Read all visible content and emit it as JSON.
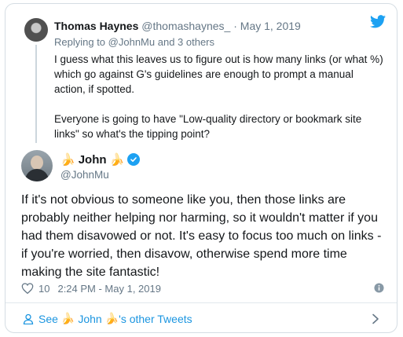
{
  "reply": {
    "name": "Thomas Haynes",
    "handle": "@thomashaynes_",
    "dot": "·",
    "date": "May 1, 2019",
    "replying_prefix": "Replying to",
    "replying_users": "@JohnMu and 3 others",
    "paragraph1": "I guess what this leaves us to figure out is how many links (or what %) which go against G's guidelines are enough to prompt a manual action, if spotted.",
    "paragraph2": "Everyone is going to have \"Low-quality directory or bookmark site links\" so what's the tipping point?"
  },
  "tweet": {
    "name_emoji_left": "🍌",
    "name": "John",
    "name_emoji_right": "🍌",
    "handle": "@JohnMu",
    "text": "If it's not obvious to someone like you, then those links are probably neither helping nor harming, so it wouldn't matter if you had them disavowed or not. It's easy to focus too much on links - if you're worried, then disavow, otherwise spend more time making the site fantastic!",
    "likes": "10",
    "timestamp": "2:24 PM - May 1, 2019"
  },
  "footer": {
    "see": "See",
    "emoji_left": "🍌",
    "name": "John",
    "emoji_right": "🍌",
    "suffix": "'s other Tweets"
  },
  "icons": {
    "brand": "twitter-bird-icon",
    "verified": "verified-badge-icon",
    "like": "heart-icon",
    "info": "info-icon",
    "user": "user-icon",
    "chevron": "chevron-right-icon"
  },
  "colors": {
    "brand": "#1da1f2",
    "link": "#1b95e0",
    "muted": "#657786"
  }
}
